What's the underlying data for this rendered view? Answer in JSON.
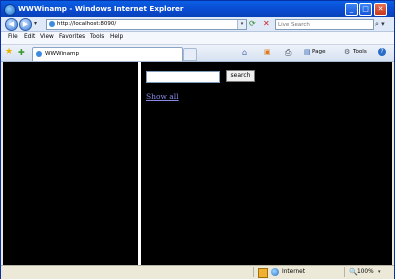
{
  "window": {
    "title": "WWWinamp - Windows Internet Explorer",
    "minimize_glyph": "_",
    "maximize_glyph": "□",
    "close_glyph": "✕"
  },
  "nav": {
    "back_glyph": "◀",
    "forward_glyph": "▶",
    "dropdown_glyph": "▾",
    "address": "http://localhost:8090/",
    "refresh_glyph": "⟳",
    "stop_glyph": "✕",
    "search_placeholder": "Live Search",
    "search_go_glyph": "⌕ ▾"
  },
  "menu": {
    "items": [
      "File",
      "Edit",
      "View",
      "Favorites",
      "Tools",
      "Help"
    ]
  },
  "tabs": {
    "favorites_glyph": "★",
    "add_favorites_glyph": "✚",
    "active_tab_label": "WWWinamp"
  },
  "command_bar": {
    "home_glyph": "⌂",
    "feeds_glyph": "▣",
    "print_glyph": "⎙",
    "page_label": "Page",
    "tools_label": "Tools",
    "help_glyph": "?"
  },
  "content": {
    "search_button_label": "search",
    "show_all_link": "Show all"
  },
  "status": {
    "zone": "Internet",
    "zoom": "100%",
    "zoom_drop_glyph": "▾"
  },
  "colors": {
    "titlebar": "#0a55d9",
    "content_background": "#000000",
    "link": "#8a8ae8"
  }
}
